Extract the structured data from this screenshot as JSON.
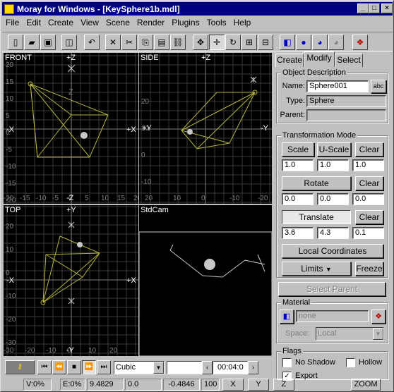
{
  "window": {
    "title": "Moray for Windows - [KeySphere1b.mdl]",
    "min": "_",
    "max": "□",
    "close": "×"
  },
  "menu": [
    "File",
    "Edit",
    "Create",
    "View",
    "Scene",
    "Render",
    "Plugins",
    "Tools",
    "Help"
  ],
  "toolbar": {
    "icons": [
      "new-icon",
      "open-icon",
      "save-icon",
      "undo-icon",
      "delete-icon",
      "cut-icon",
      "copy-icon",
      "paste-icon",
      "link-icon",
      "move-icon",
      "translate-icon",
      "rotate-icon",
      "grid-icon",
      "grid-split-icon",
      "material-icon",
      "sphere-icon",
      "render-icon",
      "render-options-icon",
      "palette-icon"
    ]
  },
  "viewports": {
    "front": {
      "label": "FRONT",
      "axis_top": "+Z",
      "axis_left": "-X",
      "axis_right": "+X",
      "axis_bottom": "-Z",
      "axis_mid": "Z",
      "y_ticks": [
        "20",
        "15",
        "10",
        "5",
        "0",
        "-5",
        "-10",
        "-15",
        "-20"
      ],
      "x_ticks": [
        "-20",
        "-15",
        "-10",
        "-5",
        "0",
        "5",
        "10",
        "15",
        "20"
      ]
    },
    "side": {
      "label": "SIDE",
      "axis_top": "+Z",
      "axis_left": "+Y",
      "axis_right": "-Y",
      "y_ticks": [
        "20",
        "10",
        "0",
        "-10",
        "-20"
      ],
      "x_ticks": [
        "20",
        "10",
        "0",
        "-10",
        "-20"
      ]
    },
    "top": {
      "label": "TOP",
      "axis_top": "+Y",
      "axis_left": "-X",
      "axis_right": "+X",
      "axis_bottom": "-Y",
      "y_ticks": [
        "20",
        "10",
        "0",
        "-10",
        "-20",
        "-30"
      ],
      "x_ticks": [
        "-30",
        "-20",
        "-10",
        "0",
        "10",
        "20"
      ]
    },
    "cam": {
      "label": "StdCam"
    }
  },
  "panel": {
    "tabs": [
      "Create",
      "Modify",
      "Select"
    ],
    "active_tab": "Modify",
    "object_description": {
      "title": "Object Description",
      "name_label": "Name:",
      "name_value": "Sphere001",
      "abc": "abc",
      "type_label": "Type:",
      "type_value": "Sphere",
      "parent_label": "Parent:",
      "parent_value": ""
    },
    "transformation": {
      "title": "Transformation Mode",
      "scale": "Scale",
      "uscale": "U-Scale",
      "clear": "Clear",
      "scale_values": [
        "1.0",
        "1.0",
        "1.0"
      ],
      "rotate": "Rotate",
      "rotate_values": [
        "0.0",
        "0.0",
        "0.0"
      ],
      "translate": "Translate",
      "translate_values": [
        "3.6",
        "4.3",
        "0.1"
      ],
      "local": "Local Coordinates",
      "limits": "Limits",
      "freeze": "Freeze"
    },
    "select_parent": "Select Parent",
    "material": {
      "title": "Material",
      "value": "none",
      "space_label": "Space:",
      "space_value": "Local"
    },
    "flags": {
      "title": "Flags",
      "no_shadow": "No Shadow",
      "hollow": "Hollow",
      "export": "Export",
      "export_checked": true
    }
  },
  "anim": {
    "interp": "Cubic",
    "time": "00:04:0"
  },
  "status": {
    "v": "V:0%",
    "e": "E:0%",
    "x": "9.4829",
    "y": "0.0",
    "z": "-0.4846",
    "zoom_val": "100",
    "bx": "X",
    "by": "Y",
    "bz": "Z",
    "zoom": "ZOOM"
  },
  "colors": {
    "wire": "#b4b43c",
    "grid": "#3a3a3a",
    "axis": "#808080",
    "title": "#000080"
  }
}
